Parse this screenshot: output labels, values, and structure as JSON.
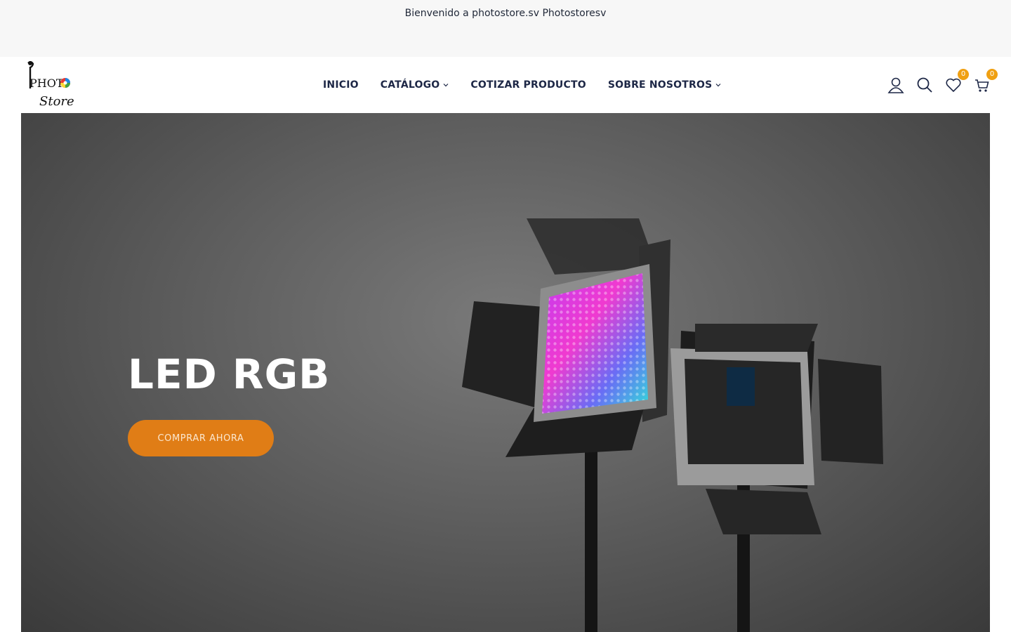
{
  "topbar": {
    "welcome": "Bienvenido a photostore.sv Photostoresv"
  },
  "logo": {
    "text": "PHOTO Store"
  },
  "nav": {
    "items": [
      {
        "label": "INICIO",
        "has_dropdown": false
      },
      {
        "label": "CATÁLOGO",
        "has_dropdown": true
      },
      {
        "label": "COTIZAR PRODUCTO",
        "has_dropdown": false
      },
      {
        "label": "SOBRE NOSOTROS",
        "has_dropdown": true
      }
    ]
  },
  "header_icons": {
    "account": "user-icon",
    "search": "search-icon",
    "wishlist": {
      "icon": "heart-icon",
      "count": "0"
    },
    "cart": {
      "icon": "cart-icon",
      "count": "0"
    }
  },
  "hero": {
    "title": "LED RGB",
    "button_label": "COMPRAR AHORA"
  },
  "colors": {
    "accent": "#e07d16",
    "badge": "#f0a012",
    "nav_text": "#1d2746"
  }
}
